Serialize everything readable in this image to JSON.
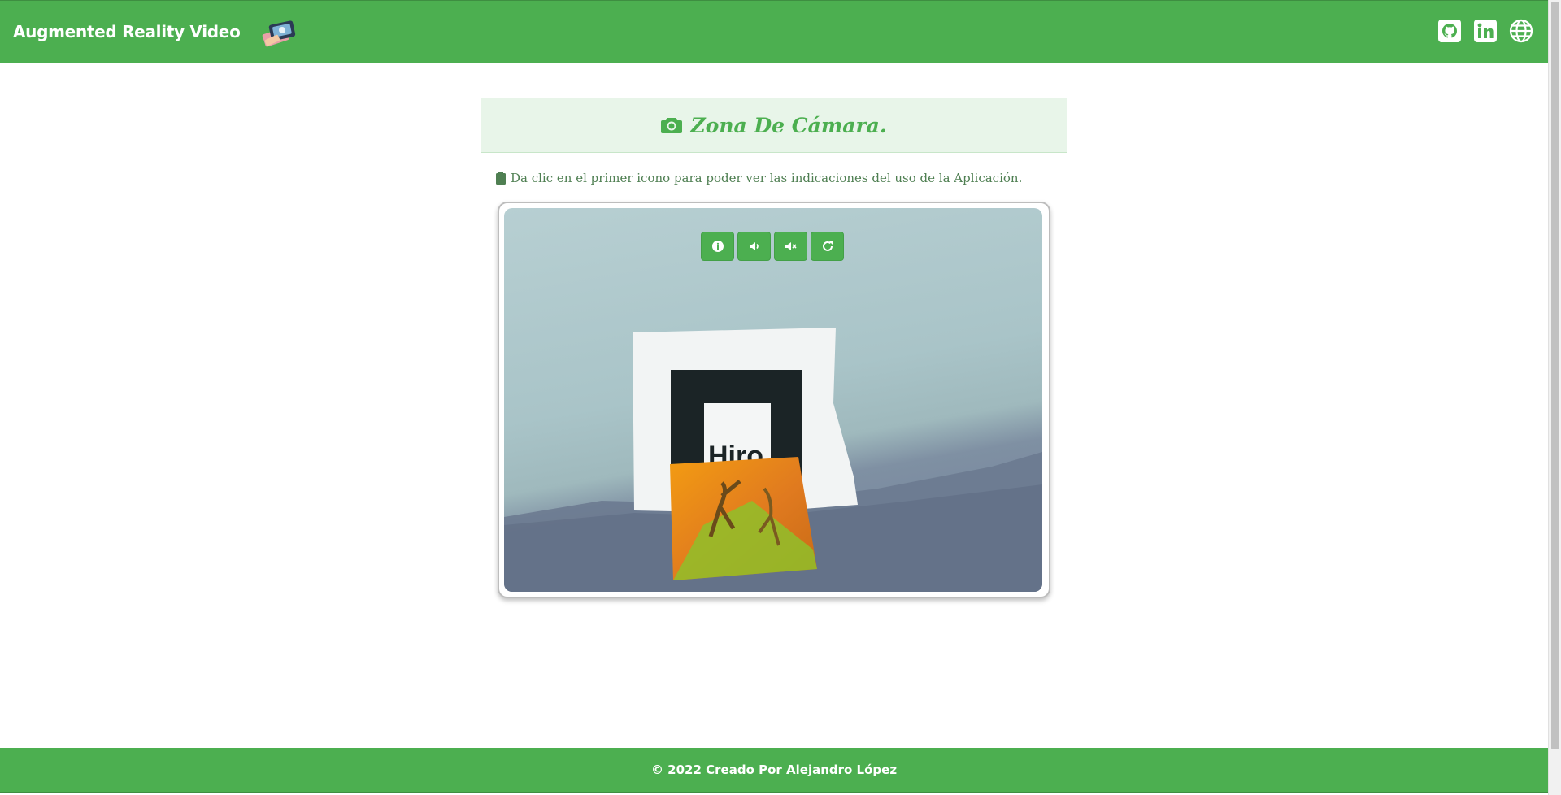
{
  "app": {
    "title": "Augmented Reality Video"
  },
  "nav": {
    "icons": [
      {
        "name": "github-icon"
      },
      {
        "name": "linkedin-icon"
      },
      {
        "name": "globe-icon"
      }
    ]
  },
  "camera": {
    "title": "Zona De Cámara.",
    "hint": "Da clic en el primer icono para poder ver las indicaciones del uso de la Aplicación.",
    "marker_text": "Hiro"
  },
  "controls": [
    {
      "name": "info-icon"
    },
    {
      "name": "volume-up-icon"
    },
    {
      "name": "volume-mute-icon"
    },
    {
      "name": "reload-icon"
    }
  ],
  "footer": {
    "text": "© 2022 Creado Por Alejandro López"
  },
  "colors": {
    "accent": "#4caf50",
    "header_bg": "#e8f5e9",
    "hint_text": "#4f7f52"
  }
}
